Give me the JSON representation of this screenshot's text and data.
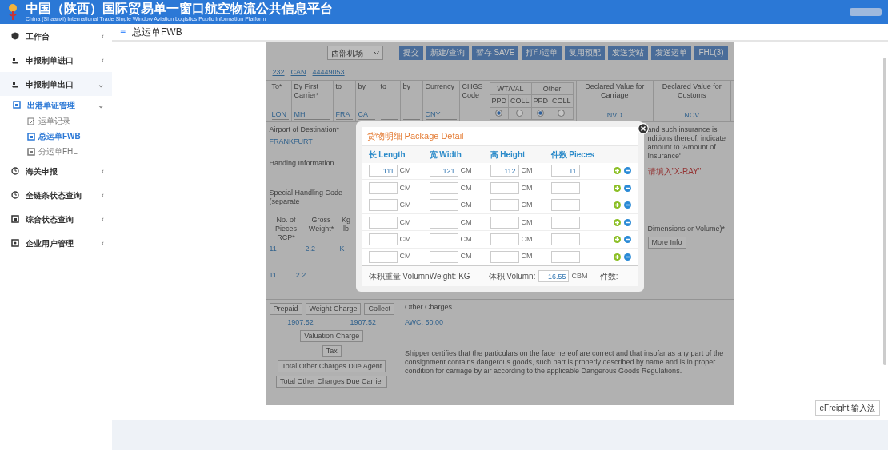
{
  "header": {
    "title": "中国（陕西）国际贸易单一窗口航空物流公共信息平台",
    "subtitle": "China (Shaanxi) International Trade Single Window Aviation Logistics Public Information Platform"
  },
  "sidebar": {
    "items": [
      {
        "label": "工作台",
        "chevron": "‹",
        "expanded": false
      },
      {
        "label": "申报制单进口",
        "chevron": "‹",
        "expanded": false
      },
      {
        "label": "申报制单出口",
        "chevron": "⌄",
        "expanded": true,
        "children": [
          {
            "label": "出港单证管理",
            "chevron": "⌄",
            "expanded": true,
            "children": [
              {
                "label": "运单记录",
                "selected": false
              },
              {
                "label": "总运单FWB",
                "selected": true
              },
              {
                "label": "分运单FHL",
                "selected": false
              }
            ]
          }
        ]
      },
      {
        "label": "海关申报",
        "chevron": "‹",
        "expanded": false
      },
      {
        "label": "全链条状态查询",
        "chevron": "‹",
        "expanded": false
      },
      {
        "label": "综合状态查询",
        "chevron": "‹",
        "expanded": false
      },
      {
        "label": "企业用户管理",
        "chevron": "‹",
        "expanded": false
      }
    ]
  },
  "page_title_icon": "≡",
  "page_title": "总运单FWB",
  "form": {
    "airport_select": "西部机场",
    "toolbar_buttons": [
      "提交",
      "新建/查询",
      "暂存 SAVE",
      "打印运单",
      "复用预配",
      "发送货站",
      "发送运单",
      "FHL(3)"
    ],
    "awb": [
      "232",
      "CAN",
      "44449053"
    ],
    "route": [
      {
        "label": "To*",
        "value": "LON"
      },
      {
        "label": "By First Carrier*",
        "value": "MH"
      },
      {
        "label": "to",
        "value": "FRA"
      },
      {
        "label": "by",
        "value": "CA"
      },
      {
        "label": "to"
      },
      {
        "label": "by"
      },
      {
        "label": "Currency",
        "value": "CNY"
      }
    ],
    "chgs": {
      "label": "CHGS Code",
      "groups": [
        {
          "label": "WT/VAL",
          "ppd": "PPD",
          "coll": "COLL",
          "ppd_checked": true,
          "coll_checked": false
        },
        {
          "label": "Other",
          "ppd": "PPD",
          "coll": "COLL",
          "ppd_checked": true,
          "coll_checked": false
        }
      ]
    },
    "declared": [
      {
        "label": "Declared Value for Carriage",
        "value": "NVD"
      },
      {
        "label": "Declared Value for Customs",
        "value": "NCV"
      }
    ],
    "airport_label": "Airport of Destination*",
    "airport_value": "FRANKFURT",
    "handling_label": "Handing Information",
    "special_label": "Special Handling Code (separate",
    "pieces_headers": [
      "No. of Pieces RCP*",
      "Gross Weight*",
      "Kg lb"
    ],
    "pieces_row": [
      "11",
      "2.2",
      "K"
    ],
    "pieces_total": [
      "11",
      "2.2"
    ],
    "insurance_text": "and such insurance is nditions thereof, indicate amount to 'Amount of Insurance'",
    "xray_note": "请填入\"X-RAY\"",
    "dimensions_label": "Dimensions or Volume)*",
    "more_info": "More Info",
    "charges": {
      "prepaid": "Prepaid",
      "weight_charge": "Weight Charge",
      "collect": "Collect",
      "prepaid_value": "1907.52",
      "collect_value": "1907.52",
      "valuation": "Valuation Charge",
      "tax": "Tax",
      "due_agent": "Total Other Charges Due Agent",
      "due_carrier": "Total Other Charges Due Carrier"
    },
    "other_charges": {
      "label": "Other Charges",
      "value": "AWC: 50.00"
    },
    "shipper_text": "Shipper certifies that the particulars on the face hereof are correct and that insofar as any part of the consignment contains dangerous goods, such part is properly described by name and is in proper condition for carriage by air according to the applicable Dangerous Goods Regulations."
  },
  "modal": {
    "title": "货物明细 Package Detail",
    "columns": [
      "长 Length",
      "宽 Width",
      "高 Height",
      "件数 Pieces"
    ],
    "rows": [
      {
        "cells": [
          {
            "value": "111",
            "unit": "CM"
          },
          {
            "value": "121",
            "unit": "CM"
          },
          {
            "value": "112",
            "unit": "CM"
          },
          {
            "value": "11"
          }
        ]
      },
      {
        "cells": [
          {
            "unit": "CM"
          },
          {
            "unit": "CM"
          },
          {
            "unit": "CM"
          },
          {}
        ]
      },
      {
        "cells": [
          {
            "unit": "CM"
          },
          {
            "unit": "CM"
          },
          {
            "unit": "CM"
          },
          {}
        ]
      },
      {
        "cells": [
          {
            "unit": "CM"
          },
          {
            "unit": "CM"
          },
          {
            "unit": "CM"
          },
          {}
        ]
      },
      {
        "cells": [
          {
            "unit": "CM"
          },
          {
            "unit": "CM"
          },
          {
            "unit": "CM"
          },
          {}
        ]
      },
      {
        "cells": [
          {
            "unit": "CM"
          },
          {
            "unit": "CM"
          },
          {
            "unit": "CM"
          },
          {}
        ]
      }
    ],
    "footer": {
      "volume_weight": "体积重量 VolumnWeight: KG",
      "volume_label": "体积 Volumn:",
      "volume_value": "16.55",
      "volume_unit": "CBM",
      "pieces_label": "件数:"
    }
  },
  "ime": "eFreight 输入法"
}
